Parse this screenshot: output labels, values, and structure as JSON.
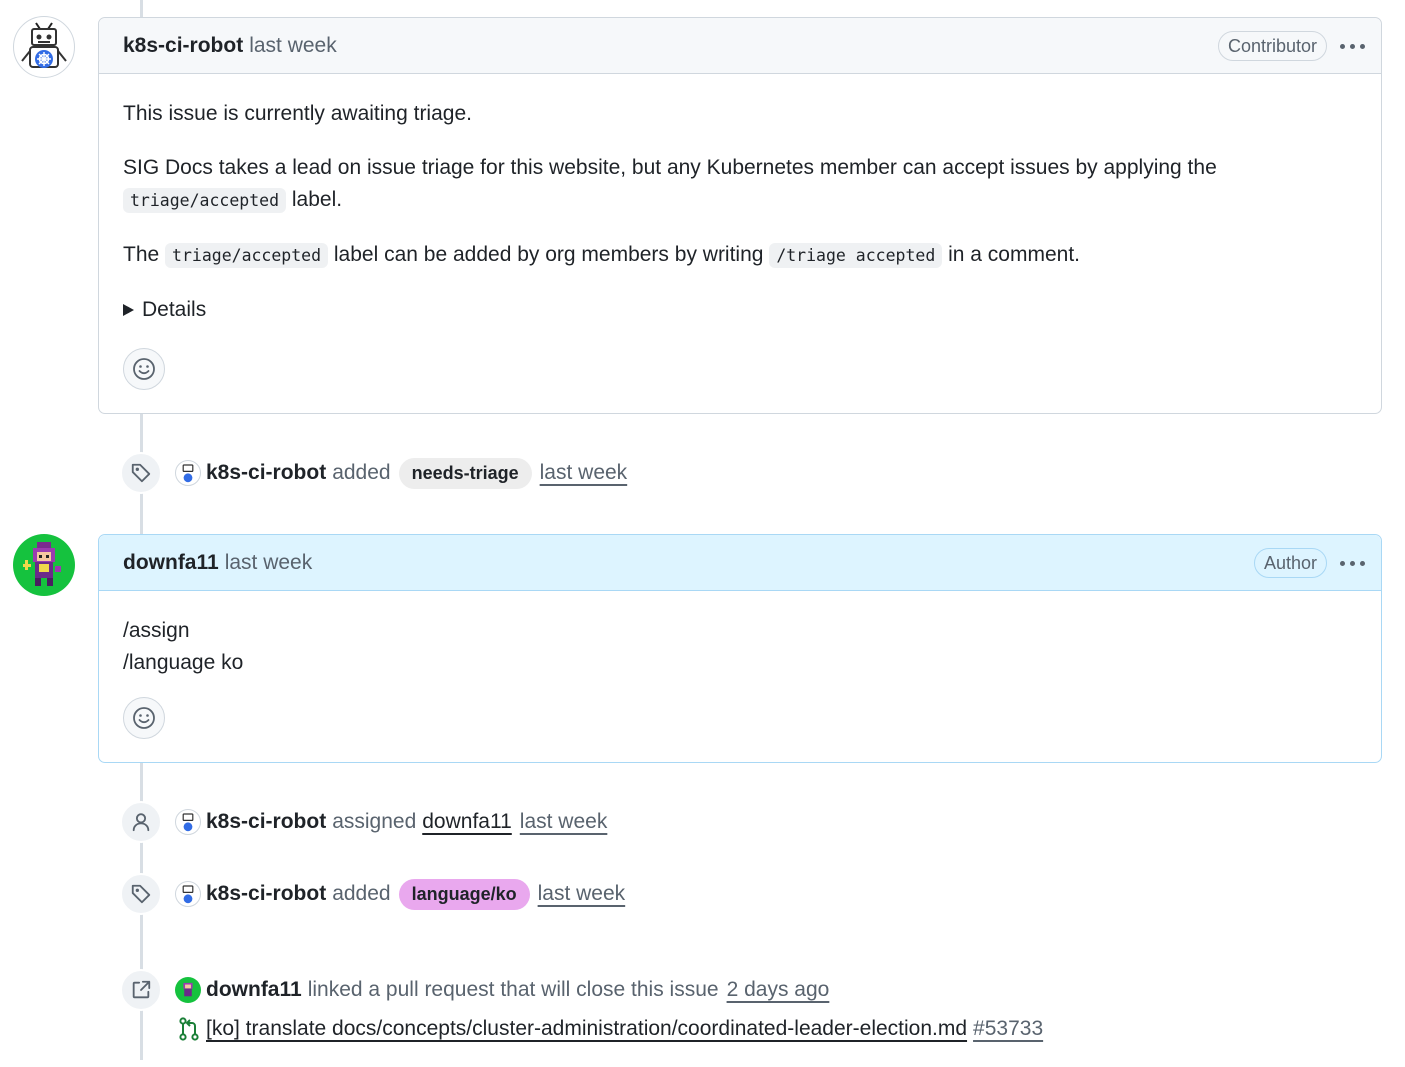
{
  "colors": {
    "label_needs_triage": "#ededed",
    "label_language_ko": "#e9a8ee",
    "author_header": "#ddf4ff",
    "pr_open_icon": "#1a7f37"
  },
  "comment1": {
    "author": "k8s-ci-robot",
    "time": "last week",
    "role": "Contributor",
    "avatar_icon": "robot-avatar-icon",
    "p1": "This issue is currently awaiting triage.",
    "p2_before": "SIG Docs takes a lead on issue triage for this website, but any Kubernetes member can accept issues by applying the",
    "p2_code": "triage/accepted",
    "p2_after": "label.",
    "p3_before": "The",
    "p3_code1": "triage/accepted",
    "p3_middle": "label can be added by org members by writing",
    "p3_code2": "/triage accepted",
    "p3_after": "in a comment.",
    "details": "Details"
  },
  "event1": {
    "icon": "tag-icon",
    "actor": "k8s-ci-robot",
    "action": "added",
    "label": "needs-triage",
    "time": "last week"
  },
  "comment2": {
    "author": "downfa11",
    "time": "last week",
    "role": "Author",
    "avatar_icon": "pixel-character-avatar-icon",
    "line1": "/assign",
    "line2": "/language ko"
  },
  "event2": {
    "icon": "person-icon",
    "actor": "k8s-ci-robot",
    "action": "assigned",
    "assignee": "downfa11",
    "time": "last week"
  },
  "event3": {
    "icon": "tag-icon",
    "actor": "k8s-ci-robot",
    "action": "added",
    "label": "language/ko",
    "time": "last week"
  },
  "event4": {
    "icon": "link-external-icon",
    "actor": "downfa11",
    "action": "linked a pull request that will close this issue",
    "time": "2 days ago",
    "pr_icon": "git-pull-request-icon",
    "pr_title": "[ko] translate docs/concepts/cluster-administration/coordinated-leader-election.md",
    "pr_number": "#53733"
  }
}
